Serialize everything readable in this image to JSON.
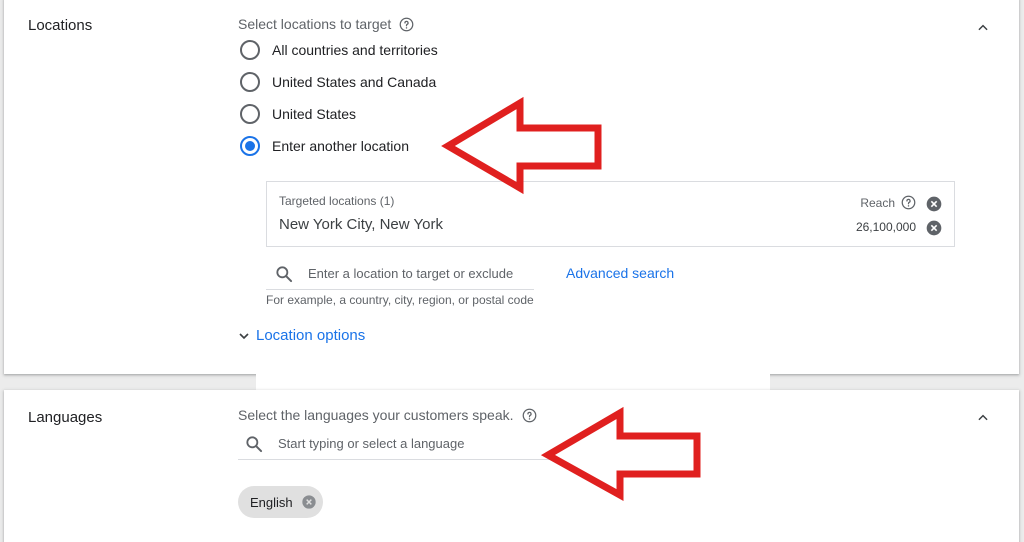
{
  "locations": {
    "title": "Locations",
    "prompt": "Select locations to target",
    "options": [
      {
        "label": "All countries and territories",
        "checked": false
      },
      {
        "label": "United States and Canada",
        "checked": false
      },
      {
        "label": "United States",
        "checked": false
      },
      {
        "label": "Enter another location",
        "checked": true
      }
    ],
    "targeted": {
      "label": "Targeted locations (1)",
      "value": "New York City, New York",
      "reach_label": "Reach",
      "reach_value": "26,100,000"
    },
    "search": {
      "placeholder": "Enter a location to target or exclude",
      "advanced_label": "Advanced search",
      "hint": "For example, a country, city, region, or postal code"
    },
    "options_toggle": "Location options"
  },
  "languages": {
    "title": "Languages",
    "prompt": "Select the languages your customers speak.",
    "search_placeholder": "Start typing or select a language",
    "chips": [
      "English"
    ]
  },
  "colors": {
    "accent": "#1a73e8",
    "annotation_arrow": "#e0201f"
  },
  "icons": [
    "help-icon",
    "chevron-up-icon",
    "cancel-icon",
    "search-icon",
    "chevron-down-icon",
    "arrow-annotation"
  ]
}
